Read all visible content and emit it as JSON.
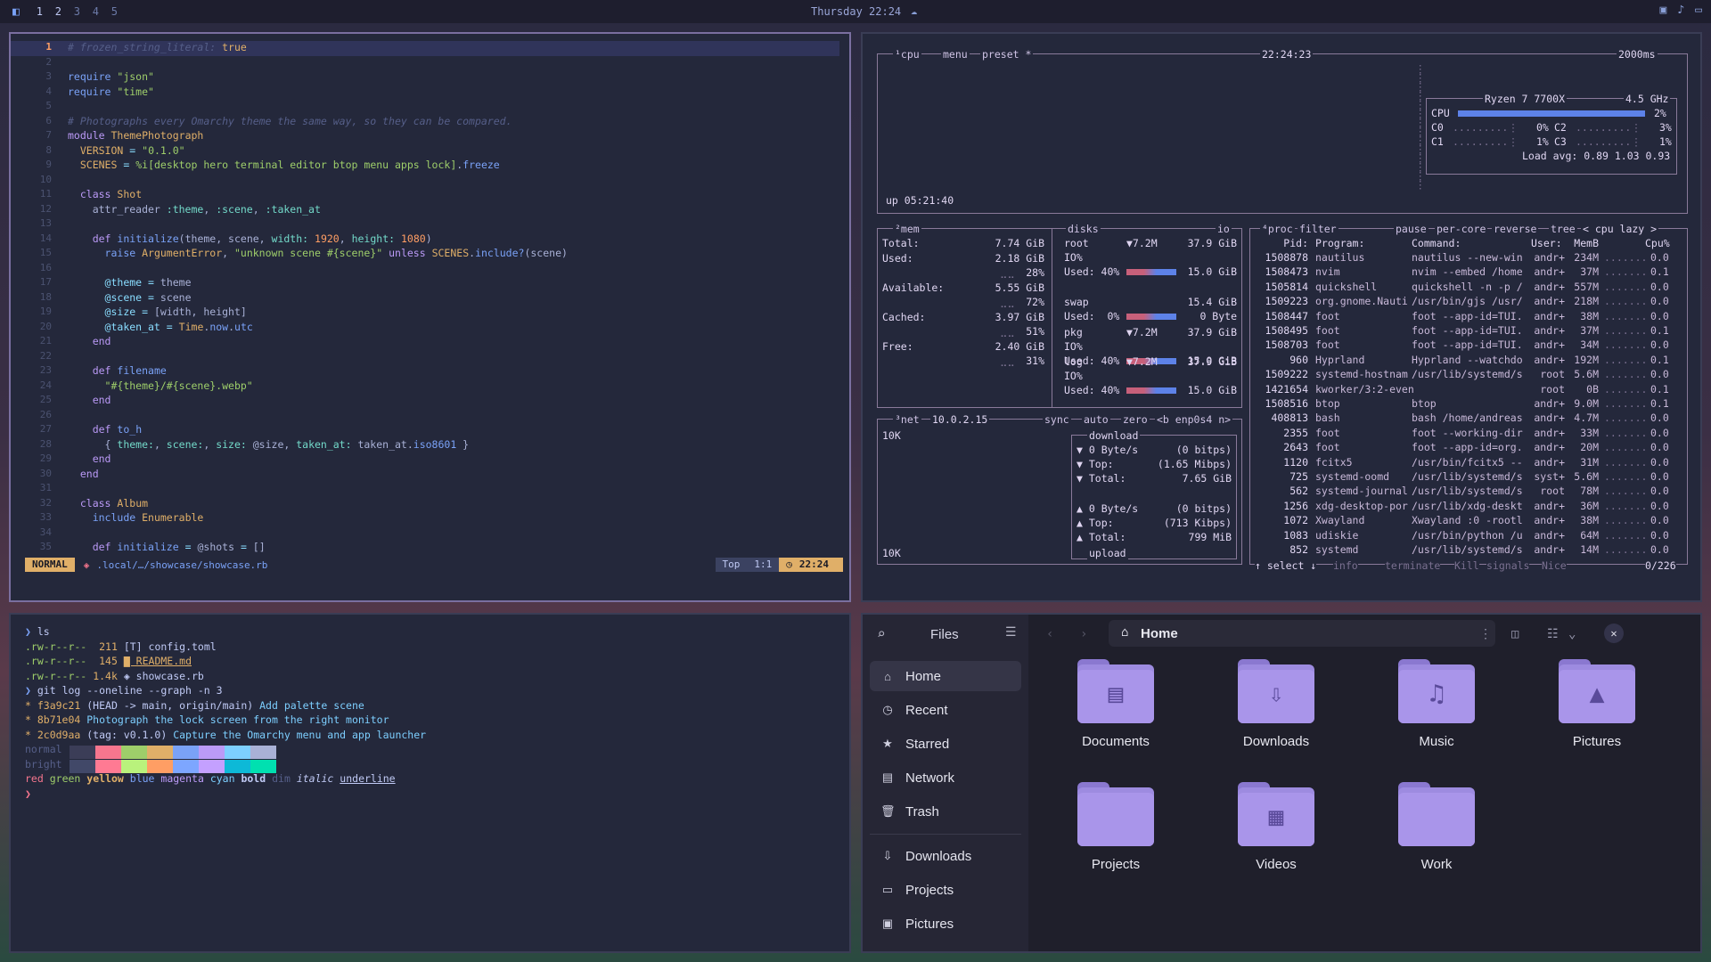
{
  "topbar": {
    "workspaces": [
      "1",
      "2",
      "3",
      "4",
      "5"
    ],
    "clock": "Thursday 22:24"
  },
  "editor": {
    "lines": [
      {
        "n": "1",
        "html": "<span class='c'># frozen_string_literal:</span> <span class='cst'>true</span>"
      },
      {
        "n": "2",
        "html": ""
      },
      {
        "n": "3",
        "html": "<span class='f'>require</span> <span class='s'>\"json\"</span>"
      },
      {
        "n": "4",
        "html": "<span class='f'>require</span> <span class='s'>\"time\"</span>"
      },
      {
        "n": "5",
        "html": ""
      },
      {
        "n": "6",
        "html": "<span class='c'># Photographs every Omarchy theme the same way, so they can be compared.</span>"
      },
      {
        "n": "7",
        "html": "<span class='k'>module</span> <span class='cst'>ThemePhotograph</span>"
      },
      {
        "n": "8",
        "html": "  <span class='cst'>VERSION</span> <span class='o'>=</span> <span class='s'>\"0.1.0\"</span>"
      },
      {
        "n": "9",
        "html": "  <span class='cst'>SCENES</span> <span class='o'>=</span> <span class='s'>%i[desktop hero terminal editor btop menu apps lock]</span>.<span class='f'>freeze</span>"
      },
      {
        "n": "10",
        "html": ""
      },
      {
        "n": "11",
        "html": "  <span class='k'>class</span> <span class='cst'>Shot</span>"
      },
      {
        "n": "12",
        "html": "    attr_reader <span class='sym'>:theme</span>, <span class='sym'>:scene</span>, <span class='sym'>:taken_at</span>"
      },
      {
        "n": "13",
        "html": ""
      },
      {
        "n": "14",
        "html": "    <span class='k'>def</span> <span class='f'>initialize</span>(theme, scene, <span class='sym'>width:</span> <span class='n'>1920</span>, <span class='sym'>height:</span> <span class='n'>1080</span>)"
      },
      {
        "n": "15",
        "html": "      <span class='f'>raise</span> <span class='cst'>ArgumentError</span>, <span class='s'>\"unknown scene #{scene}\"</span> <span class='k'>unless</span> <span class='cst'>SCENES</span>.<span class='f'>include?</span>(scene)"
      },
      {
        "n": "16",
        "html": ""
      },
      {
        "n": "17",
        "html": "      <span class='o'>@theme</span> <span class='o'>=</span> theme"
      },
      {
        "n": "18",
        "html": "      <span class='o'>@scene</span> <span class='o'>=</span> scene"
      },
      {
        "n": "19",
        "html": "      <span class='o'>@size</span> <span class='o'>=</span> [width, height]"
      },
      {
        "n": "20",
        "html": "      <span class='o'>@taken_at</span> <span class='o'>=</span> <span class='cst'>Time</span>.<span class='f'>now</span>.<span class='f'>utc</span>"
      },
      {
        "n": "21",
        "html": "    <span class='k'>end</span>"
      },
      {
        "n": "22",
        "html": ""
      },
      {
        "n": "23",
        "html": "    <span class='k'>def</span> <span class='f'>filename</span>"
      },
      {
        "n": "24",
        "html": "      <span class='s'>\"#{theme}/#{scene}.webp\"</span>"
      },
      {
        "n": "25",
        "html": "    <span class='k'>end</span>"
      },
      {
        "n": "26",
        "html": ""
      },
      {
        "n": "27",
        "html": "    <span class='k'>def</span> <span class='f'>to_h</span>"
      },
      {
        "n": "28",
        "html": "      { <span class='sym'>theme:</span>, <span class='sym'>scene:</span>, <span class='sym'>size:</span> @size, <span class='sym'>taken_at:</span> taken_at.<span class='f'>iso8601</span> }"
      },
      {
        "n": "29",
        "html": "    <span class='k'>end</span>"
      },
      {
        "n": "30",
        "html": "  <span class='k'>end</span>"
      },
      {
        "n": "31",
        "html": ""
      },
      {
        "n": "32",
        "html": "  <span class='k'>class</span> <span class='cst'>Album</span>"
      },
      {
        "n": "33",
        "html": "    <span class='f'>include</span> <span class='cst'>Enumerable</span>"
      },
      {
        "n": "34",
        "html": ""
      },
      {
        "n": "35",
        "html": "    <span class='k'>def</span> <span class='f'>initialize</span> <span class='o'>=</span> @shots <span class='o'>=</span> []"
      }
    ],
    "status": {
      "mode": "NORMAL",
      "path": ".local/…/showcase/showcase.rb",
      "top": "Top",
      "pos": "1:1",
      "time": "22:24"
    }
  },
  "btop": {
    "cpu_header": "¹cpu",
    "menu": "menu",
    "preset": "preset *",
    "time": "22:24:23",
    "interval": "2000ms",
    "cpu_model": "Ryzen 7 7700X",
    "freq": "4.5 GHz",
    "cpu_label": "CPU",
    "cpu_pct": "2%",
    "cores": [
      {
        "a": "C0",
        "ap": "0%",
        "b": "C2",
        "bp": "3%"
      },
      {
        "a": "C1",
        "ap": "1%",
        "b": "C3",
        "bp": "1%"
      }
    ],
    "load": "Load avg: 0.89 1.03 0.93",
    "uptime": "up 05:21:40",
    "mem": {
      "title": "²mem",
      "rows": [
        {
          "l": "Total:",
          "v": "7.74 GiB"
        },
        {
          "l": "Used:",
          "v": "2.18 GiB",
          "p": "28%"
        },
        {
          "l": "Available:",
          "v": "5.55 GiB",
          "p": "72%"
        },
        {
          "l": "Cached:",
          "v": "3.97 GiB",
          "p": "51%"
        },
        {
          "l": "Free:",
          "v": "2.40 GiB",
          "p": "31%"
        }
      ]
    },
    "disks": {
      "title": "disks",
      "io": "io",
      "rows": [
        {
          "name": "root",
          "io": "▼7.2M",
          "size": "37.9 GiB",
          "ioline": "IO%",
          "used": "Used: 40%",
          "usize": "15.0 GiB"
        },
        {
          "name": "swap",
          "io": "",
          "size": "15.4 GiB",
          "ioline": "",
          "used": "Used:  0%",
          "usize": "0 Byte"
        },
        {
          "name": "pkg",
          "io": "▼7.2M",
          "size": "37.9 GiB",
          "ioline": "IO%",
          "used": "Used: 40%",
          "usize": "15.0 GiB"
        },
        {
          "name": "log",
          "io": "▼7.2M",
          "size": "37.9 GiB",
          "ioline": "IO%",
          "used": "Used: 40%",
          "usize": "15.0 GiB"
        }
      ]
    },
    "net": {
      "title": "³net",
      "ip": "10.0.2.15",
      "sync": "sync",
      "auto": "auto",
      "zero": "zero",
      "iface": "<b enp0s4 n>",
      "scale_top": "10K",
      "scale_bot": "10K",
      "download": "download",
      "upload": "upload",
      "down": [
        {
          "l": "▼ 0 Byte/s",
          "r": "(0 bitps)"
        },
        {
          "l": "▼ Top:",
          "r": "(1.65 Mibps)"
        },
        {
          "l": "▼ Total:",
          "r": "7.65 GiB"
        }
      ],
      "up": [
        {
          "l": "▲ 0 Byte/s",
          "r": "(0 bitps)"
        },
        {
          "l": "▲ Top:",
          "r": "(713 Kibps)"
        },
        {
          "l": "▲ Total:",
          "r": "799 MiB"
        }
      ]
    },
    "proc": {
      "title": "⁴proc",
      "filter": "filter",
      "pause": "pause",
      "percore": "per-core",
      "reverse": "reverse",
      "tree": "tree",
      "sort": "< cpu lazy >",
      "headers": {
        "pid": "Pid:",
        "prog": "Program:",
        "cmd": "Command:",
        "user": "User:",
        "mem": "MemB",
        "cpu": "Cpu%"
      },
      "rows": [
        [
          "1508878",
          "nautilus",
          "nautilus --new-win",
          "andr+",
          "234M",
          "0.0"
        ],
        [
          "1508473",
          "nvim",
          "nvim --embed /home",
          "andr+",
          "37M",
          "0.1"
        ],
        [
          "1505814",
          "quickshell",
          "quickshell -n -p /",
          "andr+",
          "557M",
          "0.0"
        ],
        [
          "1509223",
          "org.gnome.Nauti",
          "/usr/bin/gjs /usr/",
          "andr+",
          "218M",
          "0.0"
        ],
        [
          "1508447",
          "foot",
          "foot --app-id=TUI.",
          "andr+",
          "38M",
          "0.0"
        ],
        [
          "1508495",
          "foot",
          "foot --app-id=TUI.",
          "andr+",
          "37M",
          "0.1"
        ],
        [
          "1508703",
          "foot",
          "foot --app-id=TUI.",
          "andr+",
          "34M",
          "0.0"
        ],
        [
          "960",
          "Hyprland",
          "Hyprland --watchdo",
          "andr+",
          "192M",
          "0.1"
        ],
        [
          "1509222",
          "systemd-hostnam",
          "/usr/lib/systemd/s",
          "root",
          "5.6M",
          "0.0"
        ],
        [
          "1421654",
          "kworker/3:2-even",
          "",
          "root",
          "0B",
          "0.1"
        ],
        [
          "1508516",
          "btop",
          "btop",
          "andr+",
          "9.0M",
          "0.1"
        ],
        [
          "408813",
          "bash",
          "bash /home/andreas",
          "andr+",
          "4.7M",
          "0.0"
        ],
        [
          "2355",
          "foot",
          "foot --working-dir",
          "andr+",
          "33M",
          "0.0"
        ],
        [
          "2643",
          "foot",
          "foot --app-id=org.",
          "andr+",
          "20M",
          "0.0"
        ],
        [
          "1120",
          "fcitx5",
          "/usr/bin/fcitx5 --",
          "andr+",
          "31M",
          "0.0"
        ],
        [
          "725",
          "systemd-oomd",
          "/usr/lib/systemd/s",
          "syst+",
          "5.6M",
          "0.0"
        ],
        [
          "562",
          "systemd-journal",
          "/usr/lib/systemd/s",
          "root",
          "78M",
          "0.0"
        ],
        [
          "1256",
          "xdg-desktop-por",
          "/usr/lib/xdg-deskt",
          "andr+",
          "36M",
          "0.0"
        ],
        [
          "1072",
          "Xwayland",
          "Xwayland :0 -rootl",
          "andr+",
          "38M",
          "0.0"
        ],
        [
          "1083",
          "udiskie",
          "/usr/bin/python /u",
          "andr+",
          "64M",
          "0.0"
        ],
        [
          "852",
          "systemd",
          "/usr/lib/systemd/s",
          "andr+",
          "14M",
          "0.0"
        ]
      ],
      "footer": {
        "select": "↑ select ↓",
        "info": "info",
        "terminate": "terminate",
        "kill": "Kill",
        "signals": "signals",
        "nice": "Nice",
        "count": "0/226"
      }
    }
  },
  "terminal": {
    "lines": [
      {
        "html": "<span style='color:#7aa2f7'>❯</span> <span style='color:#c0caf5'>ls</span>"
      },
      {
        "html": "<span style='color:#9ece6a'>.rw-r--r--</span>  <span style='color:#e0af68'>211</span> <span style='color:#c0caf5'>[T] config.toml</span>"
      },
      {
        "html": "<span style='color:#9ece6a'>.rw-r--r--</span>  <span style='color:#e0af68'>145</span> <span style='color:#e0af68;text-decoration:underline'>▇ README.md</span>"
      },
      {
        "html": "<span style='color:#9ece6a'>.rw-r--r--</span> <span style='color:#e0af68'>1.4k</span> <span style='color:#c0caf5'>◈ showcase.rb</span>"
      },
      {
        "html": "<span style='color:#7aa2f7'>❯</span> <span style='color:#c0caf5'>git log --oneline --graph -n 3</span>"
      },
      {
        "html": "<span style='color:#e0af68'>* f3a9c21</span> <span style='color:#c0caf5'>(HEAD -&gt; main, origin/main)</span> <span style='color:#7dcfff'>Add palette scene</span>"
      },
      {
        "html": "<span style='color:#e0af68'>* 8b71e04</span> <span style='color:#7dcfff'>Photograph the lock screen from the right monitor</span>"
      },
      {
        "html": "<span style='color:#e0af68'>* 2c0d9aa</span> <span style='color:#c0caf5'>(tag: v0.1.0)</span> <span style='color:#7dcfff'>Capture the Omarchy menu and app launcher</span>"
      },
      {
        "html": "<span style='color:#565f89'>normal</span>"
      },
      {
        "html": "<span style='color:#565f89'>bright</span>"
      },
      {
        "html": "<span style='color:#f7768e'>red</span> <span style='color:#9ece6a'>green</span> <span style='color:#e0af68;font-weight:bold'>yellow</span> <span style='color:#7aa2f7'>blue</span> <span style='color:#bb9af7'>magenta</span> <span style='color:#7dcfff'>cyan</span> <span style='color:#c0caf5;font-weight:bold'>bold</span> <span style='color:#565f89'>dim</span> <span style='color:#c0caf5;font-style:italic'>italic</span> <span style='color:#c0caf5;text-decoration:underline'>underline</span>"
      },
      {
        "html": "<span style='color:#f7768e'>❯</span>"
      }
    ],
    "palette_normal": [
      "#3b3d57",
      "#f7768e",
      "#9ece6a",
      "#e0af68",
      "#7aa2f7",
      "#bb9af7",
      "#7dcfff",
      "#a9b1d6"
    ],
    "palette_bright": [
      "#414868",
      "#ff7a93",
      "#b9f27c",
      "#ff9e64",
      "#7da6ff",
      "#c4a0ff",
      "#0db9d7",
      "#00e0b0"
    ]
  },
  "files": {
    "title": "Files",
    "location": "Home",
    "sidebar": [
      {
        "label": "Home",
        "icon": "⌂",
        "name": "home"
      },
      {
        "label": "Recent",
        "icon": "◷",
        "name": "recent"
      },
      {
        "label": "Starred",
        "icon": "★",
        "name": "starred"
      },
      {
        "label": "Network",
        "icon": "▤",
        "name": "network"
      },
      {
        "label": "Trash",
        "icon": "🗑",
        "name": "trash"
      },
      {
        "label": "Downloads",
        "icon": "⇩",
        "name": "downloads"
      },
      {
        "label": "Projects",
        "icon": "▭",
        "name": "projects"
      },
      {
        "label": "Pictures",
        "icon": "▣",
        "name": "pictures"
      }
    ],
    "folders": [
      {
        "label": "Documents",
        "glyph": "▤",
        "name": "documents"
      },
      {
        "label": "Downloads",
        "glyph": "⇩",
        "name": "downloads"
      },
      {
        "label": "Music",
        "glyph": "♫",
        "name": "music"
      },
      {
        "label": "Pictures",
        "glyph": "▲",
        "name": "pictures"
      },
      {
        "label": "Projects",
        "glyph": "",
        "name": "projects"
      },
      {
        "label": "Videos",
        "glyph": "▦",
        "name": "videos"
      },
      {
        "label": "Work",
        "glyph": "",
        "name": "work"
      }
    ]
  }
}
